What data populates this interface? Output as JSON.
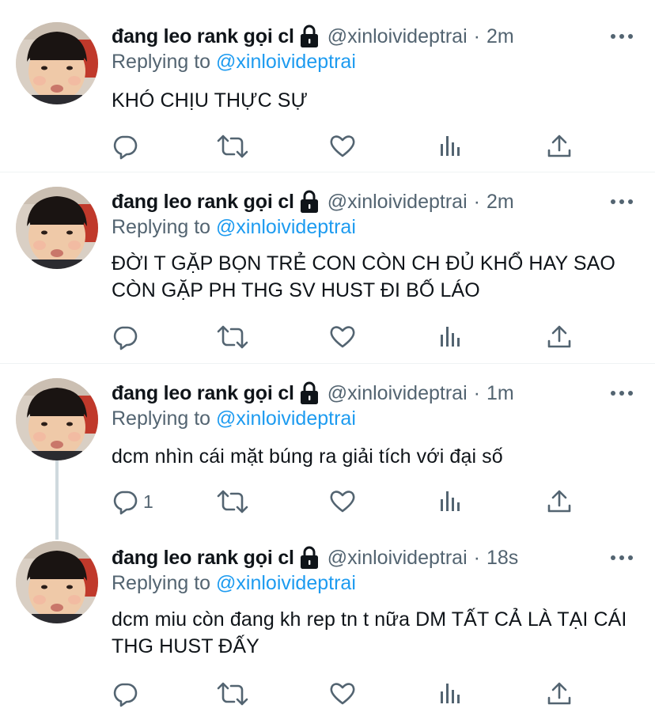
{
  "account": {
    "display_name": "đang leo rank gọi cl",
    "handle": "@xinloivideptrai",
    "protected": true
  },
  "replying_prefix": "Replying to",
  "replying_to": "@xinloivideptrai",
  "separator": "·",
  "tweets": [
    {
      "time": "2m",
      "text": "KHÓ CHỊU THỰC SỰ",
      "reply_count": ""
    },
    {
      "time": "2m",
      "text": "ĐỜI T GẶP BỌN TRẺ CON CÒN CH ĐỦ KHỔ HAY SAO CÒN GẶP PH THG SV HUST ĐI BỐ LÁO",
      "reply_count": ""
    },
    {
      "time": "1m",
      "text": "dcm nhìn cái mặt búng ra giải tích với đại số",
      "reply_count": "1"
    },
    {
      "time": "18s",
      "text": "dcm miu còn đang kh rep tn t nữa DM TẤT CẢ LÀ TẠI CÁI THG HUST ĐẤY",
      "reply_count": ""
    }
  ],
  "icons": {
    "reply": "reply-icon",
    "retweet": "retweet-icon",
    "like": "like-icon",
    "analytics": "analytics-icon",
    "share": "share-icon",
    "more": "more-icon",
    "lock": "lock-icon"
  },
  "colors": {
    "link": "#1d9bf0",
    "secondary_text": "#536471",
    "primary_text": "#0f1419",
    "divider": "#eff3f4",
    "thread_line": "#cfd9de"
  }
}
